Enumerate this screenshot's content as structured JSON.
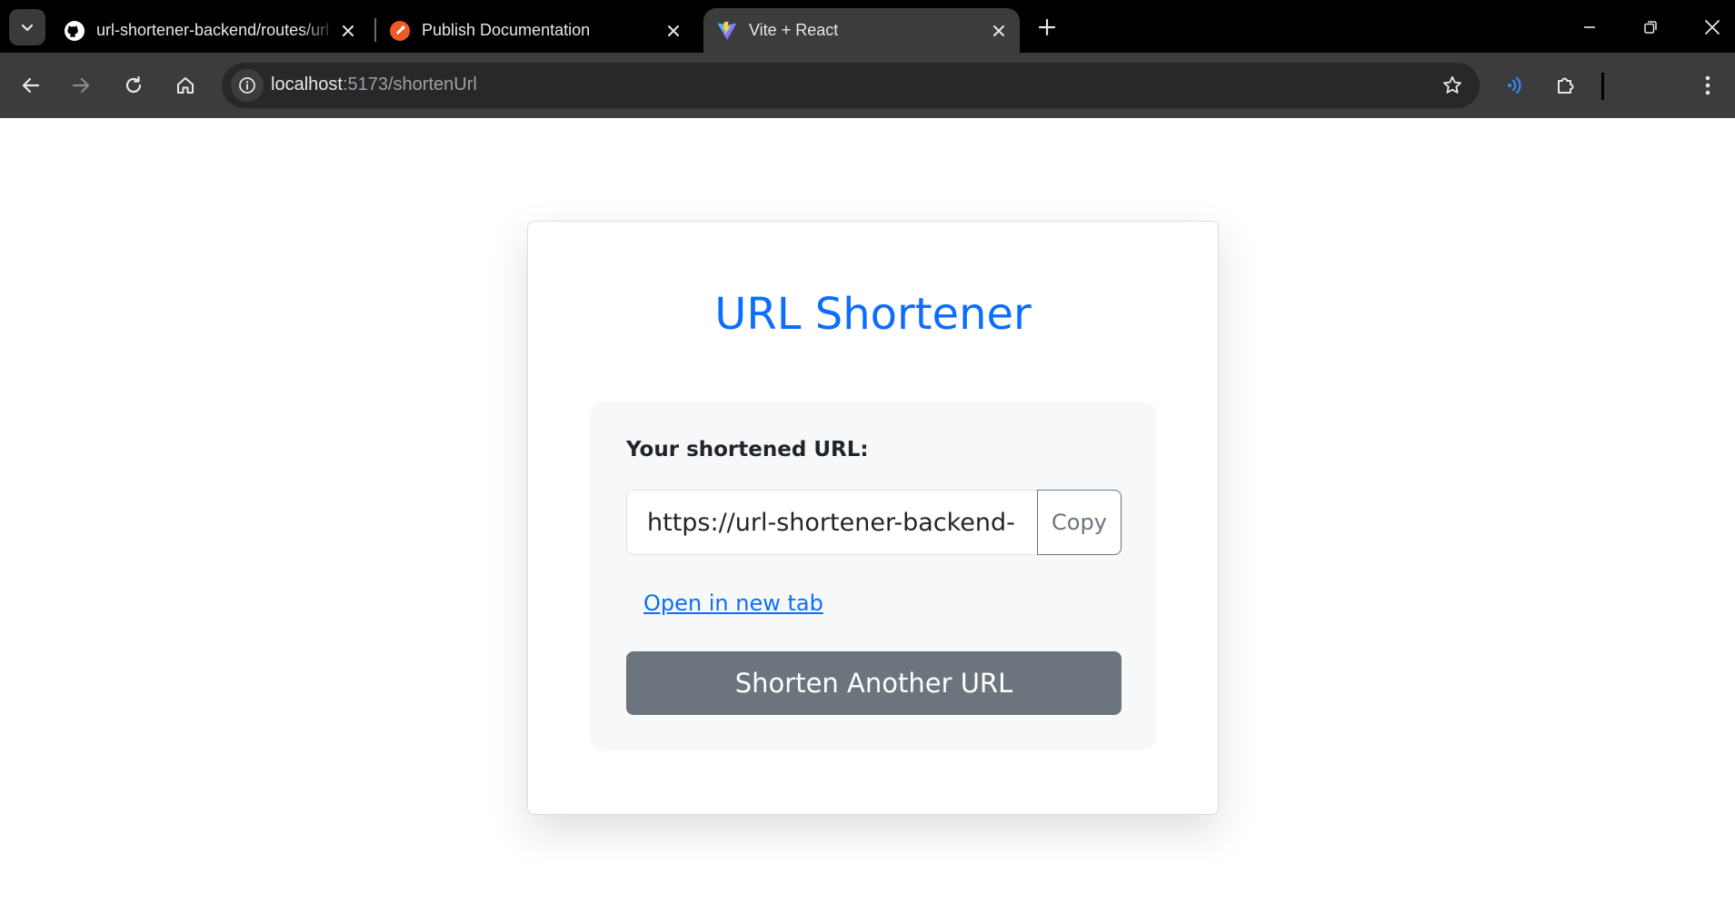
{
  "browser": {
    "tabs": [
      {
        "title": "url-shortener-backend/routes/url",
        "icon": "github-icon",
        "active": false
      },
      {
        "title": "Publish Documentation",
        "icon": "postman-icon",
        "active": false
      },
      {
        "title": "Vite + React",
        "icon": "vite-icon",
        "active": true
      }
    ],
    "address": {
      "host": "localhost",
      "rest": ":5173/shortenUrl"
    }
  },
  "app": {
    "title": "URL Shortener",
    "result_label": "Your shortened URL:",
    "short_url": "https://url-shortener-backend-",
    "copy_label": "Copy",
    "open_link_label": "Open in new tab",
    "another_button_label": "Shorten Another URL"
  },
  "colors": {
    "primary": "#0d6efd",
    "secondary": "#6c757d"
  }
}
